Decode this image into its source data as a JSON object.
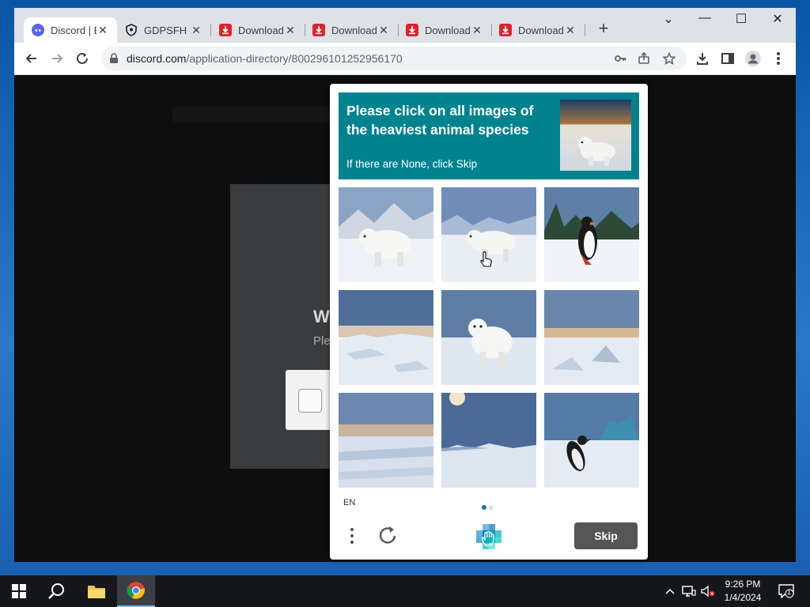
{
  "browser": {
    "tabs": [
      {
        "title": "Discord | E",
        "favicon": "discord-icon",
        "active": true
      },
      {
        "title": "GDPSFH",
        "favicon": "shield-icon",
        "active": false
      },
      {
        "title": "Download",
        "favicon": "download-icon",
        "active": false
      },
      {
        "title": "Download",
        "favicon": "download-icon",
        "active": false
      },
      {
        "title": "Download",
        "favicon": "download-icon",
        "active": false
      },
      {
        "title": "Download",
        "favicon": "download-icon",
        "active": false
      }
    ],
    "url_host": "discord.com",
    "url_path": "/application-directory/800296101252956170",
    "close_glyph": "✕",
    "newtab_glyph": "+",
    "minimize_glyph": "—",
    "maximize_glyph": "☐",
    "chevron_glyph": "⌄"
  },
  "background_page": {
    "heading": "W",
    "subtext": "Ple"
  },
  "captcha": {
    "prompt_title": "Please click on all images of the heaviest animal species",
    "prompt_hint": "If there are None, click Skip",
    "images": [
      {
        "subject": "polar bear on snow"
      },
      {
        "subject": "polar bear on snow"
      },
      {
        "subject": "penguin on snow"
      },
      {
        "subject": "snowy landscape"
      },
      {
        "subject": "polar bear"
      },
      {
        "subject": "snowy landscape"
      },
      {
        "subject": "snowy landscape"
      },
      {
        "subject": "snowy landscape"
      },
      {
        "subject": "penguin on ice"
      }
    ],
    "language": "EN",
    "page_dots": 2,
    "active_dot": 0,
    "skip_label": "Skip",
    "accent_color": "#00838f"
  },
  "taskbar": {
    "time": "9:26 PM",
    "date": "1/4/2024",
    "notification_count": "1"
  }
}
